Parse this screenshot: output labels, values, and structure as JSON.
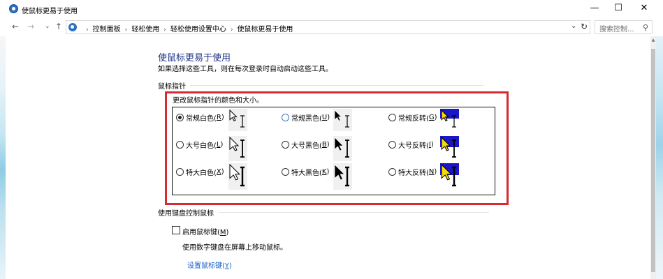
{
  "window": {
    "title": "使鼠标更易于使用",
    "minimize_glyph": "—",
    "maximize_glyph": "☐",
    "close_glyph": "✕"
  },
  "nav": {
    "back_glyph": "←",
    "forward_glyph": "→",
    "recent_glyph": "⌄",
    "up_glyph": "↑"
  },
  "address": {
    "breadcrumbs": [
      "控制面板",
      "轻松使用",
      "轻松使用设置中心",
      "使鼠标更易于使用"
    ],
    "separator": "›",
    "dropdown_glyph": "⌄",
    "refresh_glyph": "↻"
  },
  "search": {
    "placeholder": "搜索控制...",
    "icon": "search-icon"
  },
  "page": {
    "title": "使鼠标更易于使用",
    "description": "如果选择这些工具，则在每次登录时自动启动这些工具。"
  },
  "pointers": {
    "section_label": "鼠标指针",
    "sub_label": "更改鼠标指针的颜色和大小。",
    "options": [
      {
        "text": "常规白色(",
        "key": "R",
        "checked": true,
        "style": "white",
        "size": "regular"
      },
      {
        "text": "常规黑色(",
        "key": "U",
        "checked": false,
        "style": "black",
        "size": "regular"
      },
      {
        "text": "常规反转(",
        "key": "G",
        "checked": false,
        "style": "inverted",
        "size": "regular"
      },
      {
        "text": "大号白色(",
        "key": "L",
        "checked": false,
        "style": "white",
        "size": "large"
      },
      {
        "text": "大号黑色(",
        "key": "B",
        "checked": false,
        "style": "black",
        "size": "large"
      },
      {
        "text": "大号反转(",
        "key": "I",
        "checked": false,
        "style": "inverted",
        "size": "large"
      },
      {
        "text": "特大白色(",
        "key": "X",
        "checked": false,
        "style": "white",
        "size": "extra-large"
      },
      {
        "text": "特大黑色(",
        "key": "K",
        "checked": false,
        "style": "black",
        "size": "extra-large"
      },
      {
        "text": "特大反转(",
        "key": "N",
        "checked": false,
        "style": "inverted",
        "size": "extra-large"
      }
    ]
  },
  "mouse_keys": {
    "section_label": "使用键盘控制鼠标",
    "checkbox_text": "启用鼠标键(",
    "checkbox_key": "M",
    "checkbox_checked": false,
    "description": "使用数字键盘在屏幕上移动鼠标。",
    "link_text": "设置鼠标键(",
    "link_key": "Y"
  },
  "colors": {
    "highlight_border": "#d72a31",
    "title_blue": "#1e3287",
    "link_blue": "#1a5ec4",
    "inverted_bg": "#1a17c8",
    "inverted_fg": "#f3dc00"
  }
}
